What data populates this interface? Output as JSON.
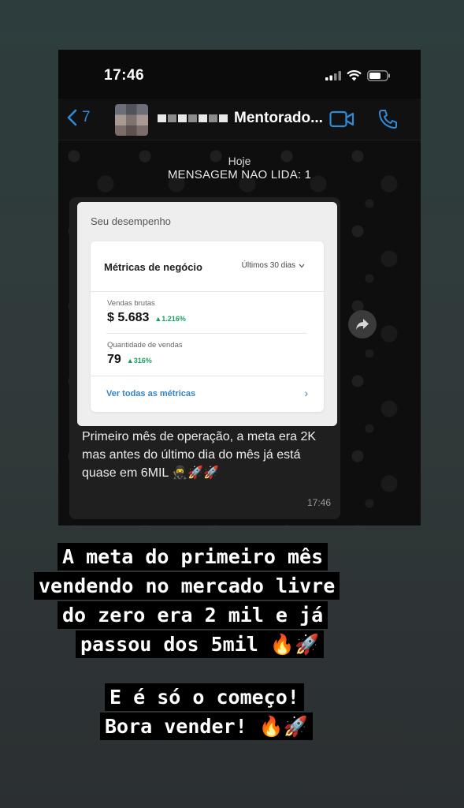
{
  "status_bar": {
    "time": "17:46"
  },
  "chat_header": {
    "back_count": "7",
    "contact_name": "Mentorado..."
  },
  "chat": {
    "date_label": "Hoje",
    "unread_banner": "MENSAGEM NAO LIDA: 1",
    "message": {
      "card": {
        "section_title": "Seu desempenho",
        "panel_title": "Métricas de negócio",
        "period": "Últimos 30 dias",
        "metrics": [
          {
            "label": "Vendas brutas",
            "value": "$ 5.683",
            "delta": "▲1.216%"
          },
          {
            "label": "Quantidade de vendas",
            "value": "79",
            "delta": "▲316%"
          }
        ],
        "link": "Ver todas as métricas"
      },
      "text": "Primeiro mês de operação, a meta era 2K mas antes do último dia do mês já está quase em 6MIL 🥷🚀🚀",
      "time": "17:46"
    }
  },
  "caption": {
    "lines": [
      "A meta do primeiro mês",
      "vendendo no mercado livre",
      "do zero era 2 mil e já",
      "passou dos 5mil 🔥🚀",
      "E é só o começo!",
      "Bora vender! 🔥🚀"
    ]
  },
  "colors": {
    "accent_blue": "#2f8bd5",
    "positive_green": "#19a05d",
    "link_blue": "#3483c6"
  },
  "icons": [
    "back-chevron-icon",
    "signal-icon",
    "wifi-icon",
    "battery-icon",
    "video-call-icon",
    "phone-icon",
    "forward-icon",
    "chevron-down-icon",
    "chevron-right-icon"
  ]
}
